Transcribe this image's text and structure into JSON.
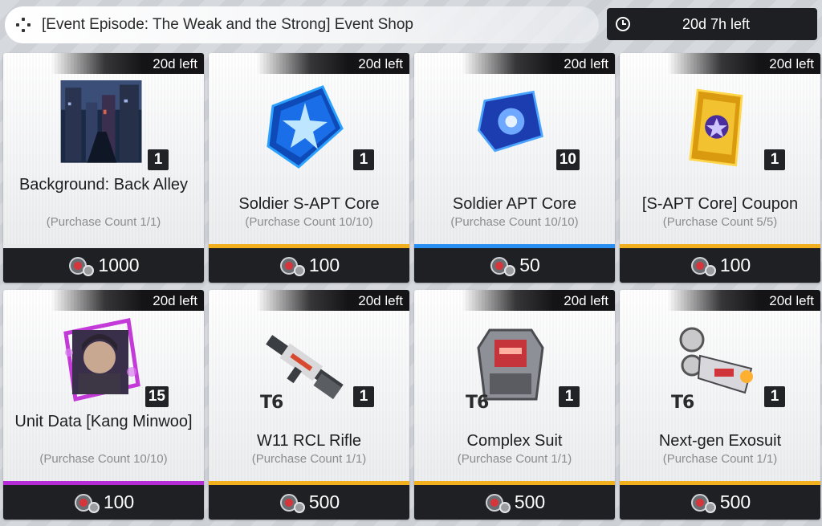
{
  "header": {
    "title": "[Event Episode: The Weak and the Strong] Event Shop",
    "menu_icon": "dots-menu-icon"
  },
  "timer": {
    "icon": "clock-icon",
    "label": "20d 7h left"
  },
  "colors": {
    "gold": "#f2b01e",
    "blue": "#2a8ff2",
    "purple": "#b52bd6",
    "none": "#e9eaec"
  },
  "items": [
    {
      "time_left": "20d left",
      "quantity": "1",
      "tier": "",
      "name": "Background: Back Alley",
      "purchase_count": "(Purchase Count 1/1)",
      "price": "1000",
      "rarity": "none",
      "icon": "back-alley-background-icon",
      "new": true
    },
    {
      "time_left": "20d left",
      "quantity": "1",
      "tier": "",
      "name": "Soldier S-APT Core",
      "purchase_count": "(Purchase Count 10/10)",
      "price": "100",
      "rarity": "gold",
      "icon": "s-apt-core-icon",
      "new": false
    },
    {
      "time_left": "20d left",
      "quantity": "10",
      "tier": "",
      "name": "Soldier APT Core",
      "purchase_count": "(Purchase Count 10/10)",
      "price": "50",
      "rarity": "blue",
      "icon": "apt-core-icon",
      "new": false
    },
    {
      "time_left": "20d left",
      "quantity": "1",
      "tier": "",
      "name": "[S-APT Core] Coupon",
      "purchase_count": "(Purchase Count 5/5)",
      "price": "100",
      "rarity": "gold",
      "icon": "coupon-icon",
      "new": false
    },
    {
      "time_left": "20d left",
      "quantity": "15",
      "tier": "",
      "name": "Unit Data [Kang Minwoo]",
      "purchase_count": "(Purchase Count 10/10)",
      "price": "100",
      "rarity": "purple",
      "icon": "unit-portrait-icon",
      "new": false
    },
    {
      "time_left": "20d left",
      "quantity": "1",
      "tier": "T6",
      "name": "W11 RCL Rifle",
      "purchase_count": "(Purchase Count 1/1)",
      "price": "500",
      "rarity": "gold",
      "icon": "rifle-icon",
      "new": false
    },
    {
      "time_left": "20d left",
      "quantity": "1",
      "tier": "T6",
      "name": "Complex Suit",
      "purchase_count": "(Purchase Count 1/1)",
      "price": "500",
      "rarity": "gold",
      "icon": "armor-suit-icon",
      "new": false
    },
    {
      "time_left": "20d left",
      "quantity": "1",
      "tier": "T6",
      "name": "Next-gen Exosuit",
      "purchase_count": "(Purchase Count 1/1)",
      "price": "500",
      "rarity": "gold",
      "icon": "exosuit-icon",
      "new": false
    }
  ]
}
